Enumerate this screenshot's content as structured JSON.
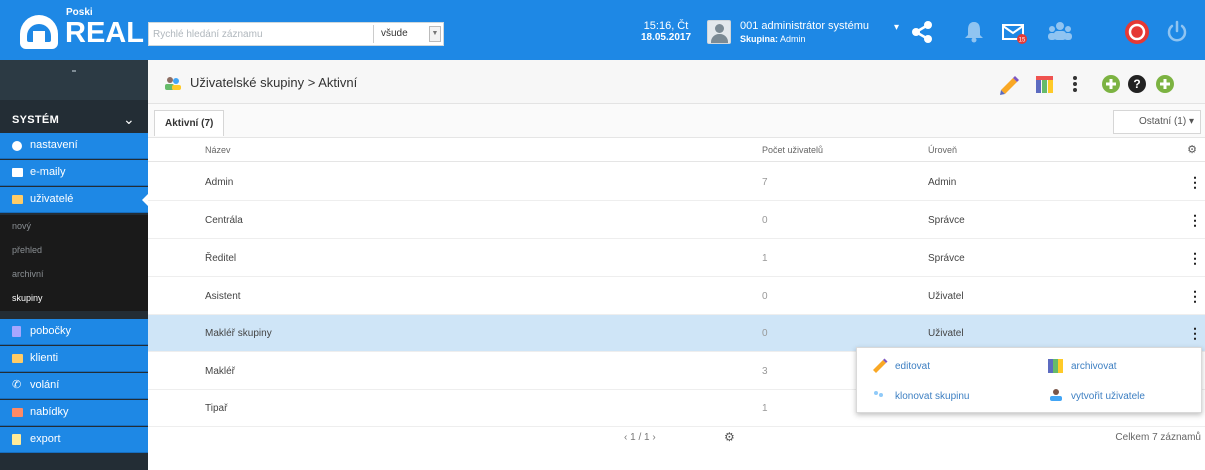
{
  "logo": {
    "small": "Poski",
    "big": "REAL"
  },
  "search": {
    "placeholder": "Rychlé hledání záznamu",
    "scope": "všude"
  },
  "clock": {
    "time": "15:16, Čt",
    "date": "18.05.2017"
  },
  "user": {
    "name": "001 administrátor systému",
    "group_label": "Skupina:",
    "group": "Admin"
  },
  "sidebar": {
    "section": "SYSTÉM",
    "items": [
      {
        "label": "nastavení",
        "icon": "gear-icon",
        "color": "#ffffff"
      },
      {
        "label": "e-maily",
        "icon": "email-icon",
        "color": "#ffffff"
      },
      {
        "label": "uživatelé",
        "icon": "users-icon",
        "color": "#ffcc66"
      }
    ],
    "subitems": [
      {
        "label": "nový"
      },
      {
        "label": "přehled"
      },
      {
        "label": "archivní"
      },
      {
        "label": "skupiny"
      }
    ],
    "items2": [
      {
        "label": "pobočky",
        "icon": "building-icon",
        "color": "#a7a6ff"
      },
      {
        "label": "klienti",
        "icon": "clients-icon",
        "color": "#ffcc66"
      },
      {
        "label": "volání",
        "icon": "phone-icon",
        "color": "#ffffff"
      },
      {
        "label": "nabídky",
        "icon": "offers-icon",
        "color": "#ff8a65"
      },
      {
        "label": "export",
        "icon": "export-icon",
        "color": "#ffeb99"
      }
    ]
  },
  "header": {
    "breadcrumb": "Uživatelské skupiny > Aktivní"
  },
  "tabs": {
    "active": "Aktivní (7)",
    "other": "Ostatní (1) ▾"
  },
  "table": {
    "columns": [
      "Název",
      "Počet uživatelů",
      "Úroveň"
    ],
    "rows": [
      {
        "name": "Admin",
        "count": "7",
        "level": "Admin"
      },
      {
        "name": "Centrála",
        "count": "0",
        "level": "Správce"
      },
      {
        "name": "Ředitel",
        "count": "1",
        "level": "Správce"
      },
      {
        "name": "Asistent",
        "count": "0",
        "level": "Uživatel"
      },
      {
        "name": "Makléř skupiny",
        "count": "0",
        "level": "Uživatel"
      },
      {
        "name": "Makléř",
        "count": "3",
        "level": ""
      },
      {
        "name": "Tipař",
        "count": "1",
        "level": ""
      }
    ]
  },
  "context_menu": {
    "edit": "editovat",
    "archive": "archivovat",
    "clone": "klonovat skupinu",
    "create_user": "vytvořit uživatele"
  },
  "pager": {
    "text": "‹  1 / 1  ›"
  },
  "footer": {
    "total": "Celkem 7 záznamů"
  },
  "colors": {
    "brand": "#1e88e5",
    "sidebar": "#232d35",
    "selected_row": "#cfe5f7"
  }
}
